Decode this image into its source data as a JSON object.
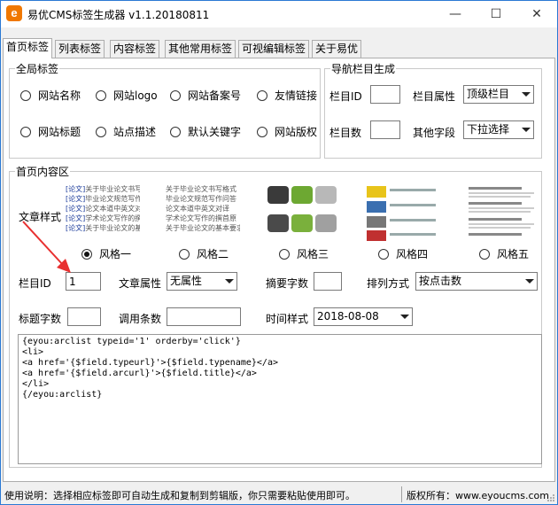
{
  "window": {
    "title": "易优CMS标签生成器 v1.1.20180811",
    "icon_letter": "e",
    "minimize_glyph": "—",
    "maximize_glyph": "☐",
    "close_glyph": "✕"
  },
  "tabs": [
    {
      "label": "首页标签"
    },
    {
      "label": "列表标签"
    },
    {
      "label": "内容标签"
    },
    {
      "label": "其他常用标签"
    },
    {
      "label": "可视编辑标签"
    },
    {
      "label": "关于易优"
    }
  ],
  "global": {
    "legend": "全局标签",
    "options": [
      {
        "label": "网站名称"
      },
      {
        "label": "网站logo"
      },
      {
        "label": "网站备案号"
      },
      {
        "label": "友情链接"
      },
      {
        "label": "网站标题"
      },
      {
        "label": "站点描述"
      },
      {
        "label": "默认关键字"
      },
      {
        "label": "网站版权"
      }
    ]
  },
  "nav": {
    "legend": "导航栏目生成",
    "catid_label": "栏目ID",
    "catid_value": "",
    "attr_label": "栏目属性",
    "attr_value": "顶级栏目",
    "count_label": "栏目数",
    "count_value": "",
    "other_label": "其他字段",
    "other_value": "下拉选择"
  },
  "content": {
    "legend": "首页内容区",
    "style_label": "文章样式",
    "styles": [
      {
        "label": "风格一",
        "selected": true
      },
      {
        "label": "风格二",
        "selected": false
      },
      {
        "label": "风格三",
        "selected": false
      },
      {
        "label": "风格四",
        "selected": false
      },
      {
        "label": "风格五",
        "selected": false
      }
    ],
    "thumb1_rows": [
      {
        "tag": "[论文]",
        "text": "关于毕业论文书写格"
      },
      {
        "tag": "[论文]",
        "text": "毕业论文规范写作要"
      },
      {
        "tag": "[论文]",
        "text": "论文本道中英文对译"
      },
      {
        "tag": "[论文]",
        "text": "学术论文写作的撰"
      },
      {
        "tag": "[论文]",
        "text": "关于毕业论文的基本"
      }
    ],
    "thumb2_rows": [
      {
        "text": "关于毕业论文书写格式"
      },
      {
        "text": "毕业论文规范写作问答"
      },
      {
        "text": "论文本道中英文对译"
      },
      {
        "text": "学术论文写作的撰首原"
      },
      {
        "text": "关于毕业论文的基本要求"
      }
    ],
    "catid_label": "栏目ID",
    "catid_value": "1",
    "article_attr_label": "文章属性",
    "article_attr_value": "无属性",
    "summary_label": "摘要字数",
    "summary_value": "",
    "order_label": "排列方式",
    "order_value": "按点击数",
    "title_len_label": "标题字数",
    "title_len_value": "",
    "count_label": "调用条数",
    "count_value": "",
    "time_label": "时间样式",
    "time_value": "2018-08-08"
  },
  "code": "{eyou:arclist typeid='1' orderby='click'}\n<li>\n<a href='{$field.typeurl}'>{$field.typename}</a>\n<a href='{$field.arcurl}'>{$field.title}</a>\n</li>\n{/eyou:arclist}",
  "status": {
    "left": "使用说明：选择相应标签即可自动生成和复制到剪辑版，你只需要粘贴使用即可。",
    "right": "版权所有：www.eyoucms.com"
  },
  "colors": {
    "arrow": "#e83030",
    "accent": "#f07800"
  }
}
